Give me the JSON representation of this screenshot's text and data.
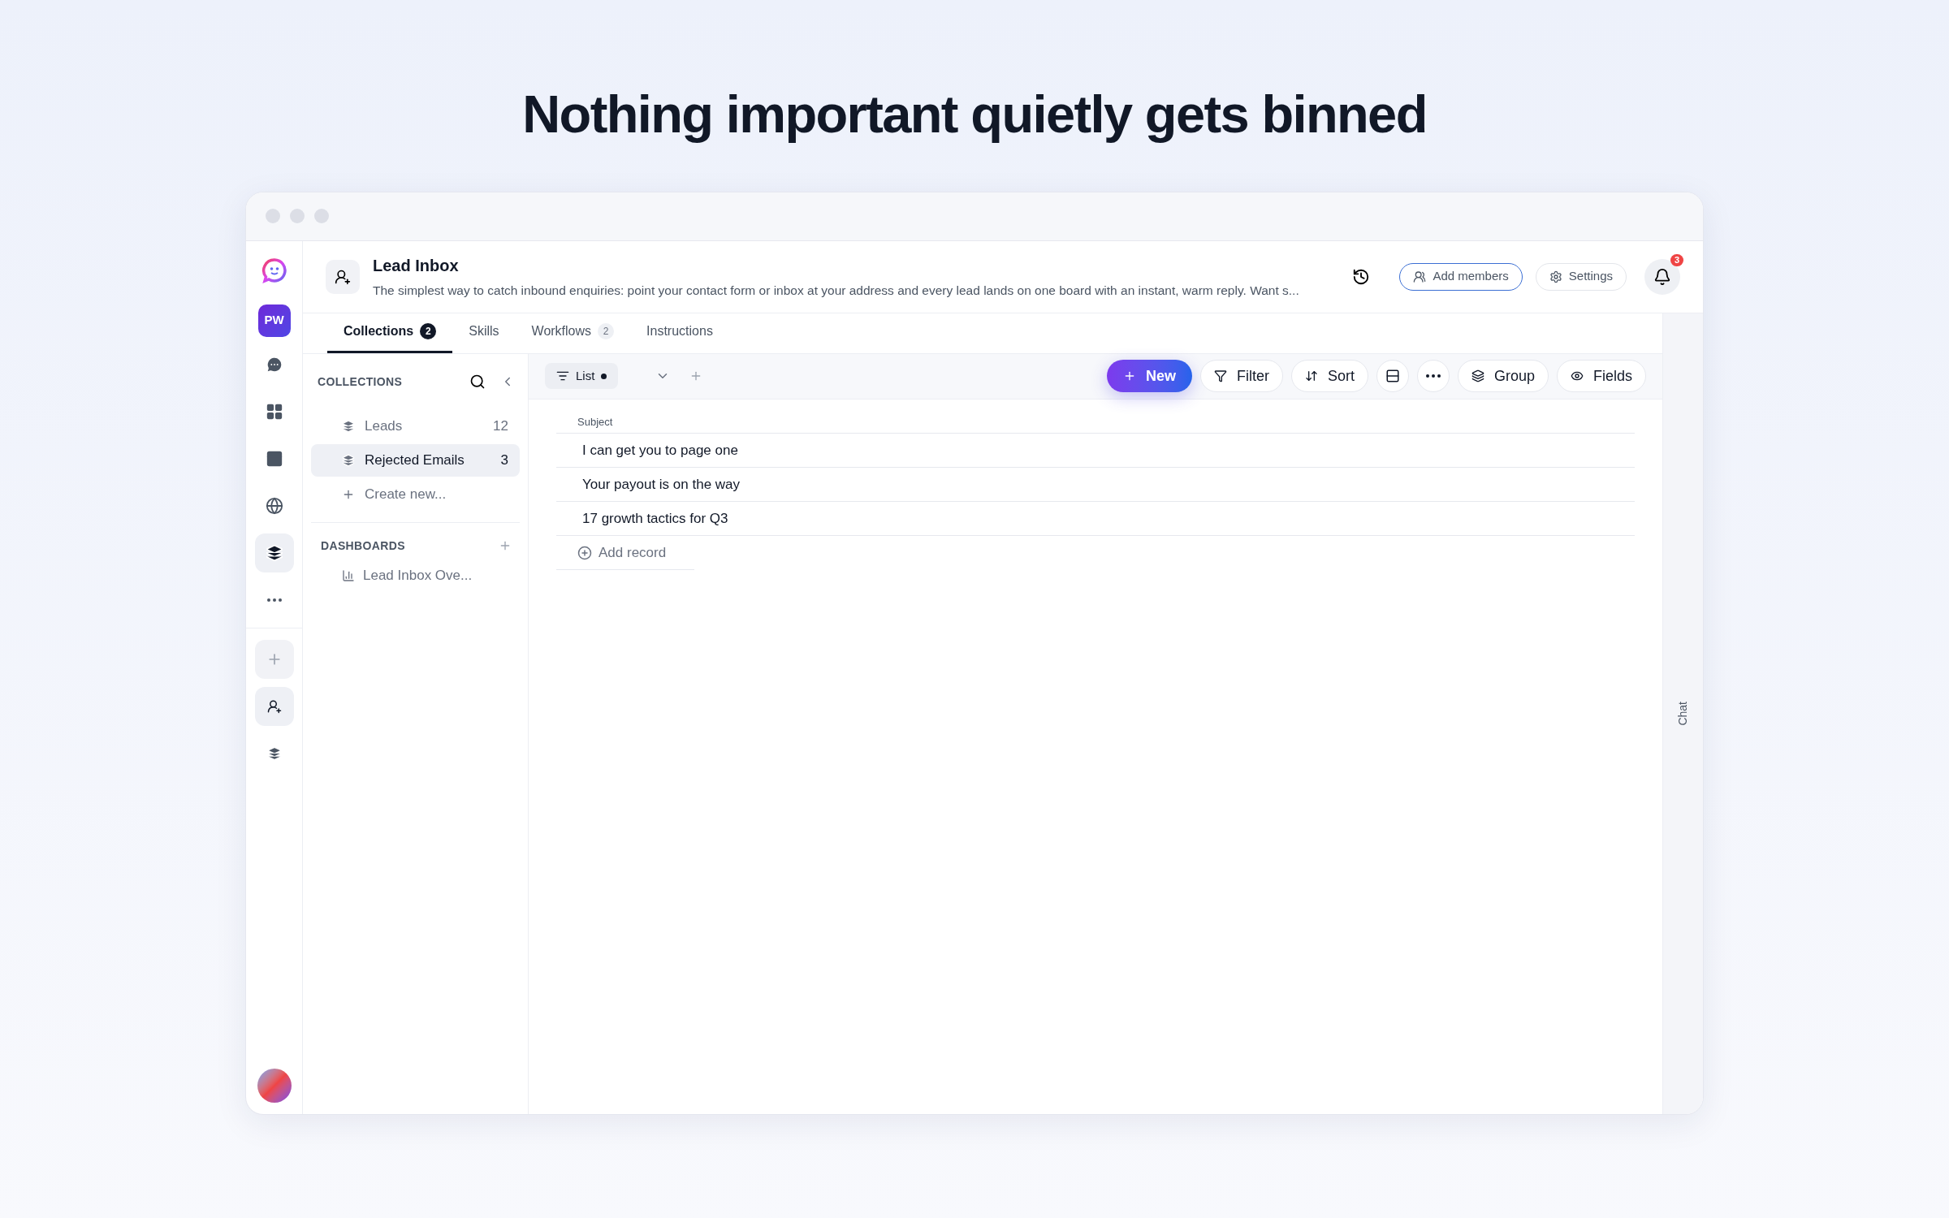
{
  "headline": "Nothing important quietly gets binned",
  "rail": {
    "workspace": "PW",
    "items": [
      {
        "selected": false
      },
      {
        "selected": false
      },
      {
        "selected": false
      },
      {
        "selected": false
      },
      {
        "selected": true
      },
      {
        "selected": false
      }
    ],
    "pinned": [
      {
        "selected": true
      },
      {
        "selected": false
      }
    ]
  },
  "header": {
    "title": "Lead Inbox",
    "description": "The simplest way to catch inbound enquiries: point your contact form or inbox at your address and every lead lands on one board with an instant, warm reply. Want s...",
    "buttons": [
      {
        "label": "Add members",
        "kind": "outline-accent"
      },
      {
        "label": "Settings",
        "kind": "outline"
      }
    ],
    "notifications": "3"
  },
  "tabs": [
    {
      "label": "Collections",
      "count": "2",
      "selected": true
    },
    {
      "label": "Skills",
      "selected": false
    },
    {
      "label": "Workflows",
      "count": "2",
      "selected": false
    },
    {
      "label": "Instructions",
      "selected": false
    }
  ],
  "collections": {
    "heading": "COLLECTIONS",
    "items": [
      {
        "label": "Leads",
        "count": "12",
        "selected": false
      },
      {
        "label": "Rejected Emails",
        "count": "3",
        "selected": true
      }
    ],
    "create": "Create new..."
  },
  "dashboards": {
    "heading": "DASHBOARDS",
    "items": [
      "Lead Inbox Ove..."
    ]
  },
  "view": {
    "label": "List",
    "modified": true
  },
  "toolbar": [
    {
      "kind": "primary",
      "label": "New"
    },
    {
      "kind": "pill",
      "label": "Filter"
    },
    {
      "kind": "pill",
      "label": "Sort"
    },
    {
      "kind": "icon"
    },
    {
      "kind": "icon"
    },
    {
      "kind": "pill",
      "label": "Group"
    },
    {
      "kind": "pill",
      "label": "Fields"
    }
  ],
  "table": {
    "columns": [
      "Subject"
    ],
    "rows": [
      [
        "I can get you to page one"
      ],
      [
        "Your payout is on the way"
      ],
      [
        "17 growth tactics for Q3"
      ]
    ],
    "add": "Add record"
  },
  "chat_tab": "Chat"
}
